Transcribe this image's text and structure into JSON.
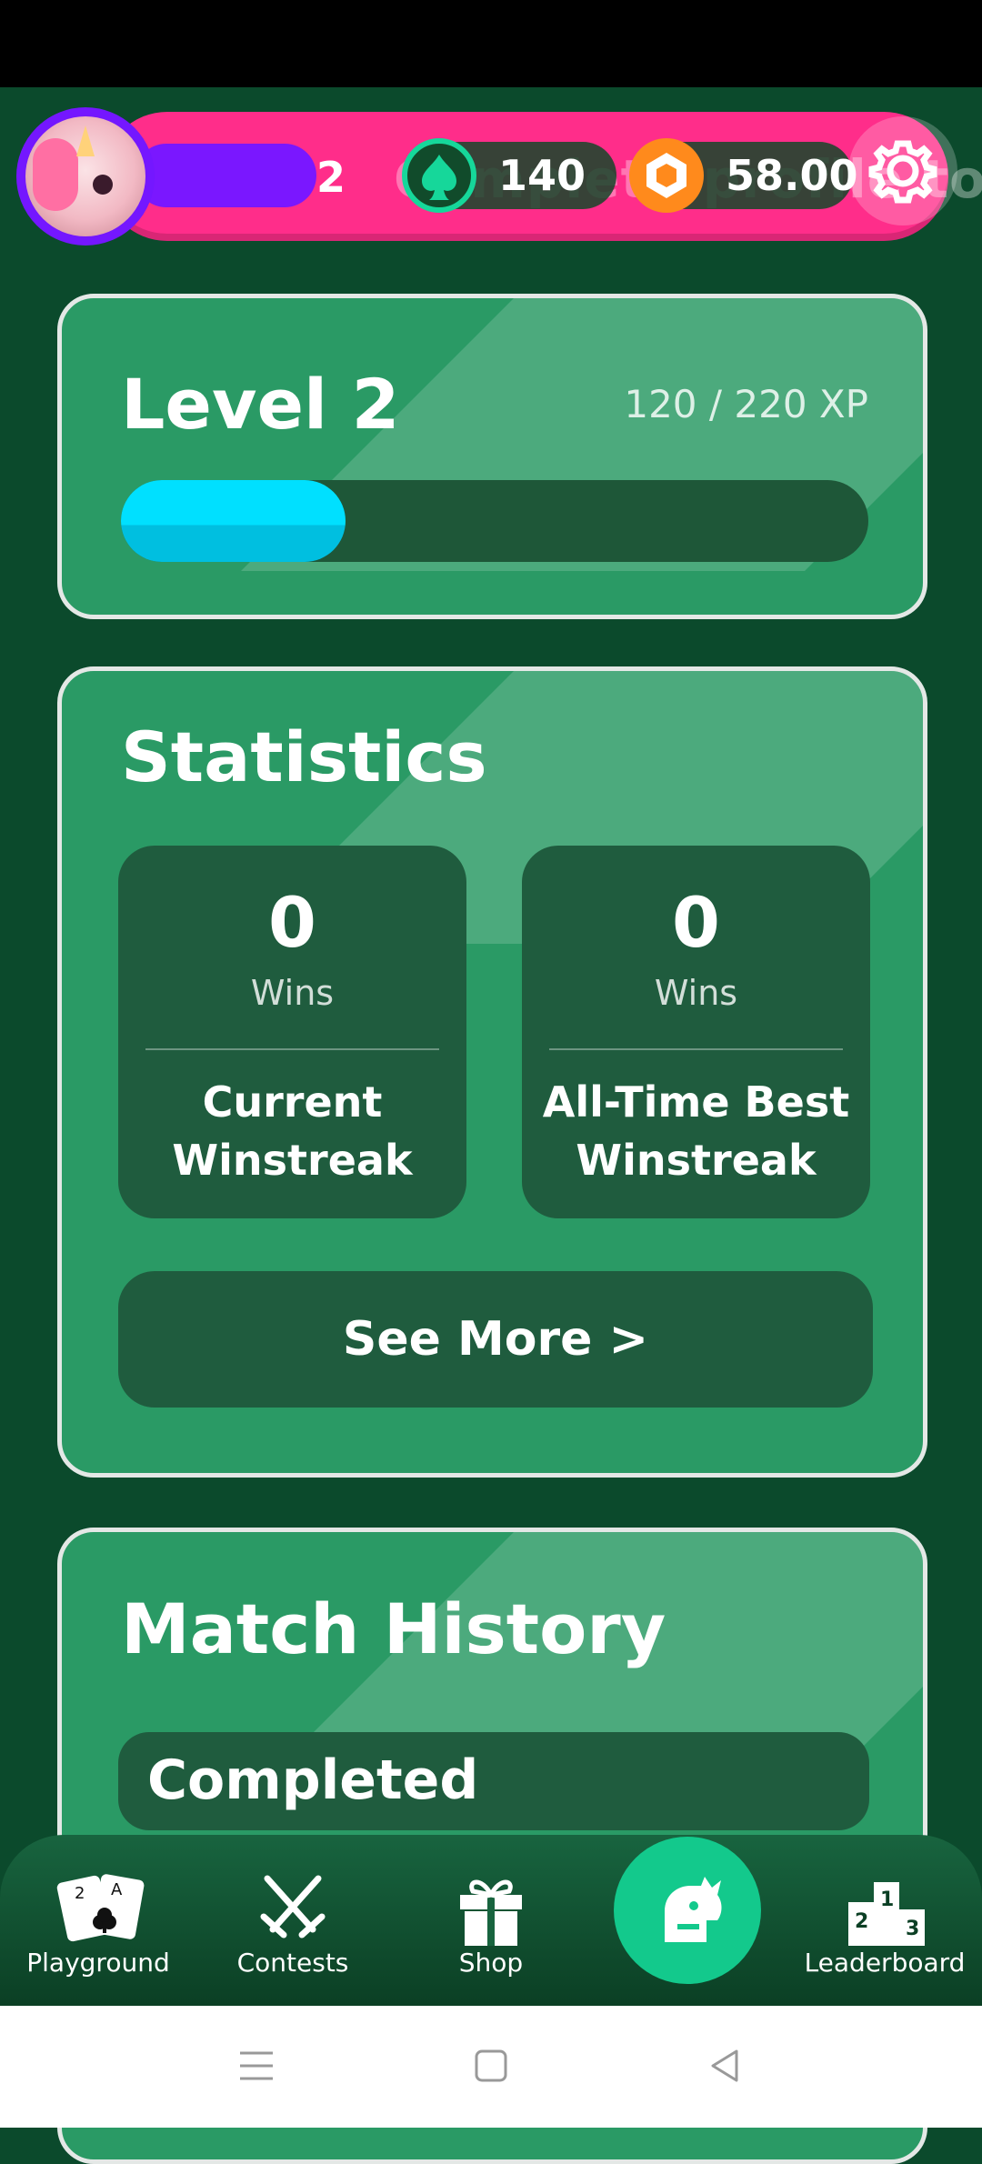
{
  "header": {
    "player_level": "2",
    "ghost_banner": "Complete profile to",
    "spades_balance": "140",
    "gems_balance": "58.00"
  },
  "level_card": {
    "title": "Level 2",
    "xp_text": "120 / 220 XP",
    "xp_current": 120,
    "xp_total": 220
  },
  "statistics": {
    "title": "Statistics",
    "current": {
      "value": "0",
      "unit": "Wins",
      "label_line1": "Current",
      "label_line2": "Winstreak"
    },
    "best": {
      "value": "0",
      "unit": "Wins",
      "label_line1": "All-Time Best",
      "label_line2": "Winstreak"
    },
    "see_more": "See More >"
  },
  "match_history": {
    "title": "Match History",
    "filter": "Completed"
  },
  "nav": {
    "items": [
      {
        "label": "Playground",
        "icon": "cards-icon"
      },
      {
        "label": "Contests",
        "icon": "crossed-swords-icon"
      },
      {
        "label": "Shop",
        "icon": "gift-icon"
      },
      {
        "label": "",
        "icon": "profile-knight-icon"
      },
      {
        "label": "Leaderboard",
        "icon": "podium-icon"
      }
    ]
  },
  "colors": {
    "background": "#0b4a2c",
    "card": "#2a9a65",
    "xp_fill": "#00e0ff",
    "header_pink": "#ff2d8a",
    "avatar_ring": "#7417ff",
    "fab": "#13c98c"
  }
}
